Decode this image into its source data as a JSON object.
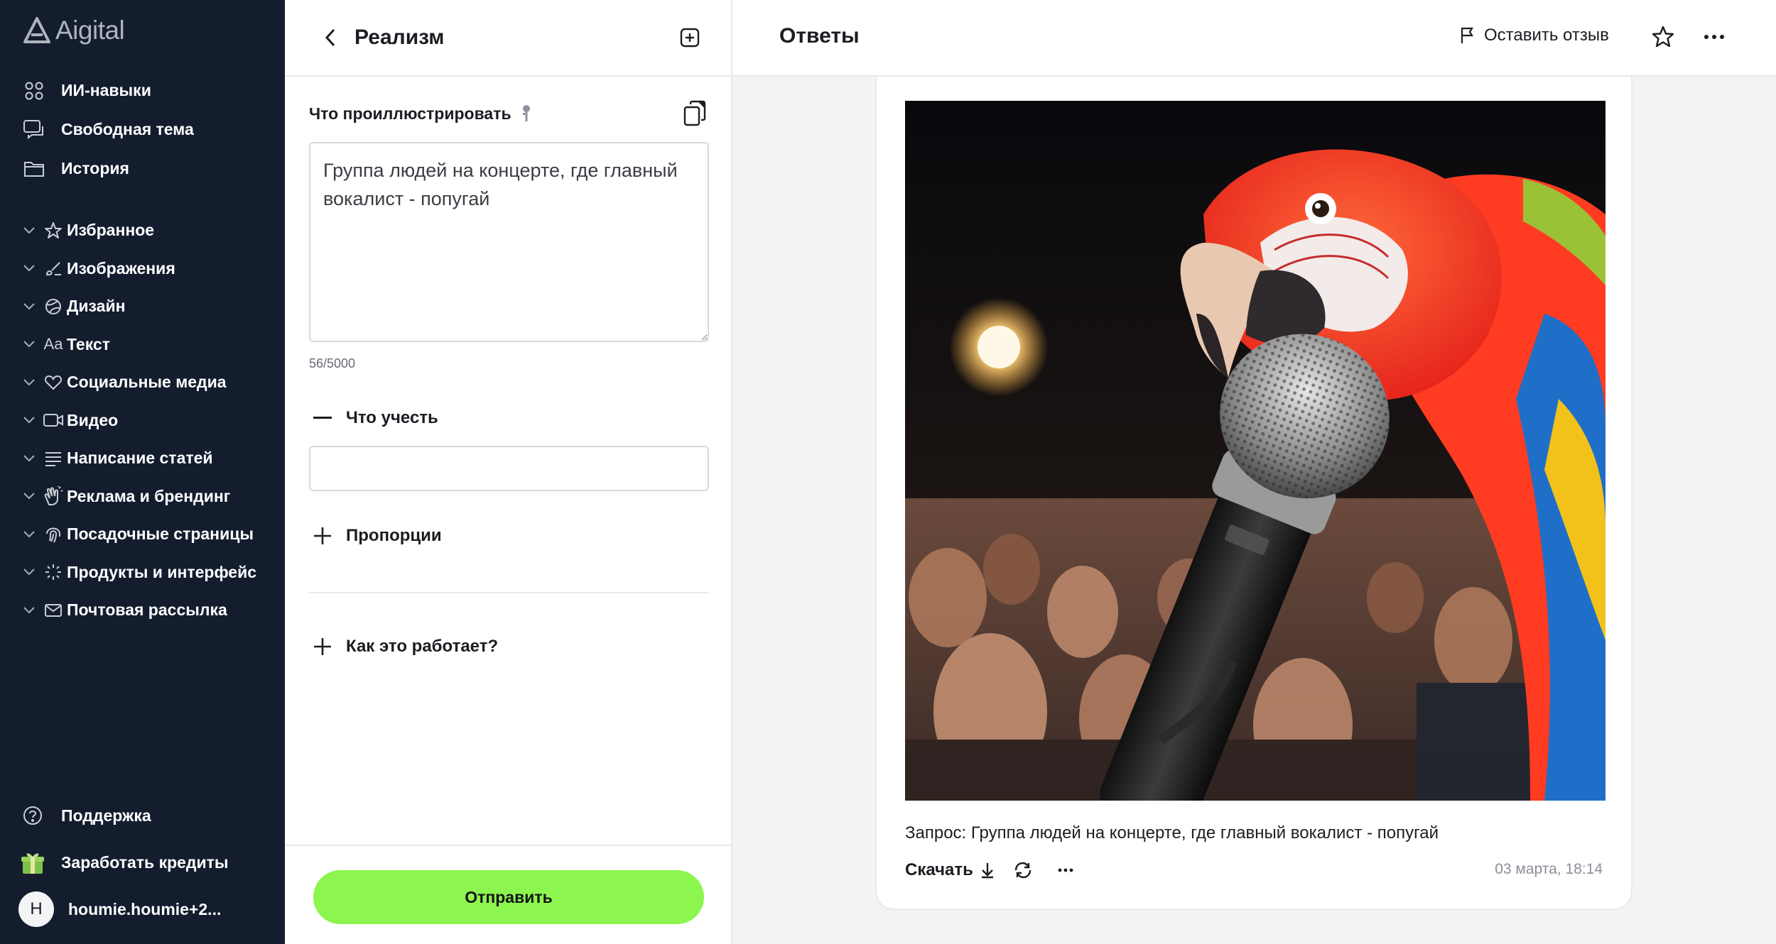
{
  "app": {
    "name": "Aigital"
  },
  "sidebar": {
    "top": [
      {
        "label": "ИИ-навыки",
        "icon": "skills-grid-icon"
      },
      {
        "label": "Свободная тема",
        "icon": "chat-bubbles-icon"
      },
      {
        "label": "История",
        "icon": "folder-icon"
      }
    ],
    "categories": [
      {
        "label": "Избранное",
        "icon": "star-icon"
      },
      {
        "label": "Изображения",
        "icon": "brush-icon"
      },
      {
        "label": "Дизайн",
        "icon": "globe-icon"
      },
      {
        "label": "Текст",
        "icon": "text-aa-icon",
        "icon_text": "Aa"
      },
      {
        "label": "Социальные медиа",
        "icon": "heart-icon"
      },
      {
        "label": "Видео",
        "icon": "video-camera-icon"
      },
      {
        "label": "Написание статей",
        "icon": "lines-icon"
      },
      {
        "label": "Реклама и брендинг",
        "icon": "clapping-hands-icon"
      },
      {
        "label": "Посадочные страницы",
        "icon": "fingerprint-icon"
      },
      {
        "label": "Продукты и интерфейс",
        "icon": "sparkle-icon"
      },
      {
        "label": "Почтовая рассылка",
        "icon": "envelope-icon"
      }
    ],
    "bottom": {
      "support": "Поддержка",
      "credits": "Заработать кредиты",
      "user_initial": "H",
      "user_name": "houmie.houmie+2..."
    }
  },
  "form": {
    "title": "Реализм",
    "prompt_label": "Что проиллюстрировать",
    "prompt_value": "Группа людей на концерте, где главный вокалист - попугай",
    "counter": "56/5000",
    "consider_label": "Что учесть",
    "consider_value": "",
    "proportions_label": "Пропорции",
    "how_label": "Как это работает?",
    "submit_label": "Отправить"
  },
  "main": {
    "title": "Ответы",
    "feedback_label": "Оставить отзыв",
    "result": {
      "query": "Запрос: Группа людей на концерте, где главный вокалист - попугай",
      "download_label": "Скачать",
      "timestamp": "03 марта, 18:14"
    }
  },
  "colors": {
    "sidebar_bg": "#131d2e",
    "accent_green": "#8cf54e"
  }
}
